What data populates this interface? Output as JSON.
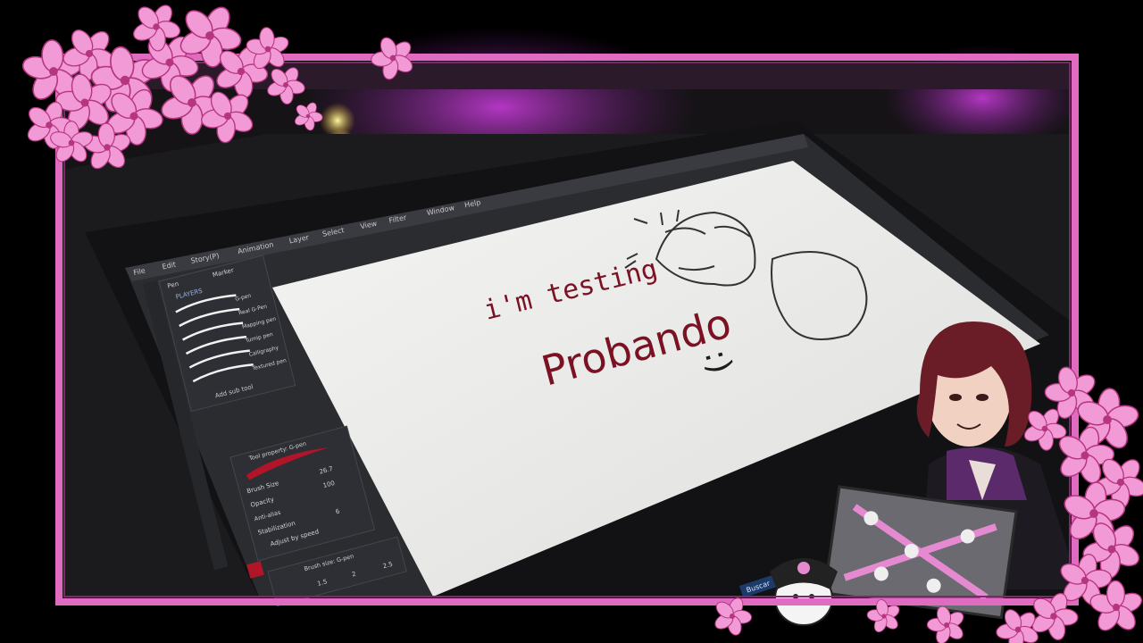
{
  "overlay": {
    "frame_color": "#e06cc2",
    "blossom_color": "#f29ad6",
    "blossom_dark": "#b5357f"
  },
  "app": {
    "menu": [
      "File",
      "Edit",
      "Story(P)",
      "Animation",
      "Layer",
      "Select",
      "View",
      "Filter",
      "Window",
      "Help"
    ],
    "tool_palette": {
      "tabs": [
        "Pen",
        "Marker"
      ],
      "set_name": "PLAYERS",
      "brushes": [
        "G-pen",
        "Real G-Pen",
        "Mapping pen",
        "Turnip pen",
        "Calligraphy",
        "Textured pen"
      ],
      "add_sub_tool": "Add sub tool"
    },
    "tool_property": {
      "title": "Tool property: G-pen",
      "brush_size_label": "Brush Size",
      "brush_size_value": "26.7",
      "opacity_label": "Opacity",
      "opacity_value": "100",
      "antialias_label": "Anti-alias",
      "stabilization_label": "Stabilization",
      "stabilization_value": "6",
      "adjust_label": "Adjust by speed"
    },
    "brush_size_panel": {
      "title": "Brush size: G-pen",
      "values": [
        "1.5",
        "2",
        "2.5"
      ]
    },
    "search_label": "Buscar"
  },
  "canvas": {
    "text_english": "i'm testing",
    "text_spanish": "Probando",
    "smiley": ":)",
    "ink_color": "#7a1224"
  }
}
